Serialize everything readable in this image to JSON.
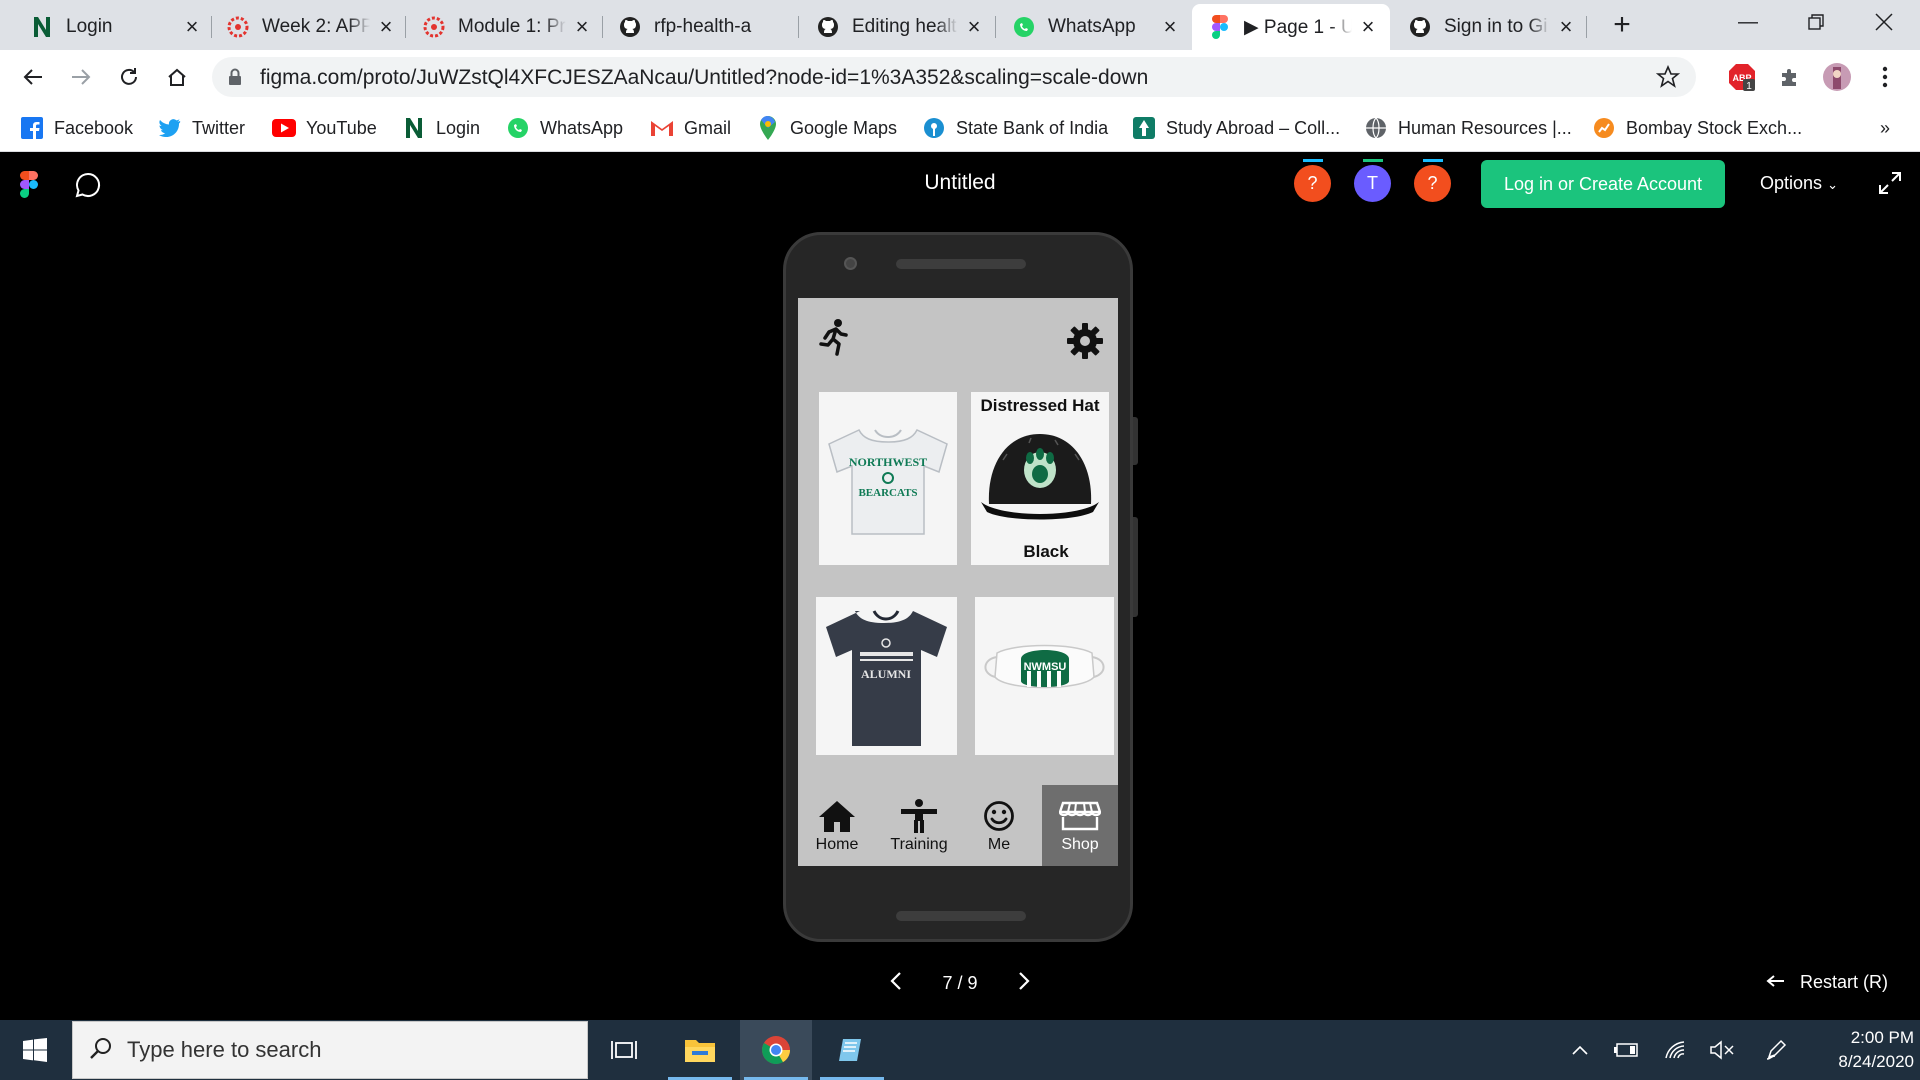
{
  "browser": {
    "tabs": [
      {
        "title": "Login",
        "favicon": "notion-n-icon"
      },
      {
        "title": "Week 2: APP",
        "favicon": "canvas-icon"
      },
      {
        "title": "Module 1: Pr",
        "favicon": "canvas-icon"
      },
      {
        "title": "rfp-health-a",
        "favicon": "github-icon"
      },
      {
        "title": "Editing healt",
        "favicon": "github-icon"
      },
      {
        "title": "WhatsApp",
        "favicon": "whatsapp-icon"
      },
      {
        "title": "▶ Page 1 - U",
        "favicon": "figma-icon"
      },
      {
        "title": "Sign in to Gi",
        "favicon": "github-icon"
      }
    ],
    "active_tab_index": 6,
    "url": "figma.com/proto/JuWZstQl4XFCJESZAaNcau/Untitled?node-id=1%3A352&scaling=scale-down",
    "extension_badge": "1",
    "bookmarks": [
      {
        "label": "Facebook",
        "icon": "facebook-icon"
      },
      {
        "label": "Twitter",
        "icon": "twitter-icon"
      },
      {
        "label": "YouTube",
        "icon": "youtube-icon"
      },
      {
        "label": "Login",
        "icon": "notion-n-icon"
      },
      {
        "label": "WhatsApp",
        "icon": "whatsapp-icon"
      },
      {
        "label": "Gmail",
        "icon": "gmail-icon"
      },
      {
        "label": "Google Maps",
        "icon": "maps-icon"
      },
      {
        "label": "State Bank of India",
        "icon": "sbi-icon"
      },
      {
        "label": "Study Abroad – Coll...",
        "icon": "study-icon"
      },
      {
        "label": "Human Resources |...",
        "icon": "globe-icon"
      },
      {
        "label": "Bombay Stock Exch...",
        "icon": "bse-icon"
      }
    ],
    "bookmarks_more": "»"
  },
  "figma": {
    "file_title": "Untitled",
    "avatars": [
      {
        "label": "?",
        "color": "#f24e1e"
      },
      {
        "label": "T",
        "color": "#6a5cff"
      },
      {
        "label": "?",
        "color": "#f24e1e"
      }
    ],
    "login_button": "Log in or Create Account",
    "options_label": "Options",
    "pager": "7 / 9",
    "restart": "Restart (R)"
  },
  "app": {
    "products": [
      {
        "name": "Northwest Bearcats white t-shirt",
        "print_line1": "NORTHWEST",
        "print_line2": "BEARCATS"
      },
      {
        "title": "Distressed Hat",
        "color_label": "Black"
      },
      {
        "name": "Northwest Alumni navy t-shirt",
        "print": "ALUMNI"
      },
      {
        "name": "NWMSU face mask",
        "print": "NWMSU"
      }
    ],
    "nav": [
      {
        "label": "Home",
        "icon": "home-icon"
      },
      {
        "label": "Training",
        "icon": "training-icon"
      },
      {
        "label": "Me",
        "icon": "smiley-icon"
      },
      {
        "label": "Shop",
        "icon": "shop-icon"
      }
    ],
    "active_nav": "Shop",
    "colors": {
      "screen_bg": "#c4c4c4",
      "nav_active": "#6e6e6e",
      "bearcat_green": "#0f6b44"
    }
  },
  "taskbar": {
    "search_placeholder": "Type here to search",
    "time": "2:00 PM",
    "date": "8/24/2020"
  }
}
